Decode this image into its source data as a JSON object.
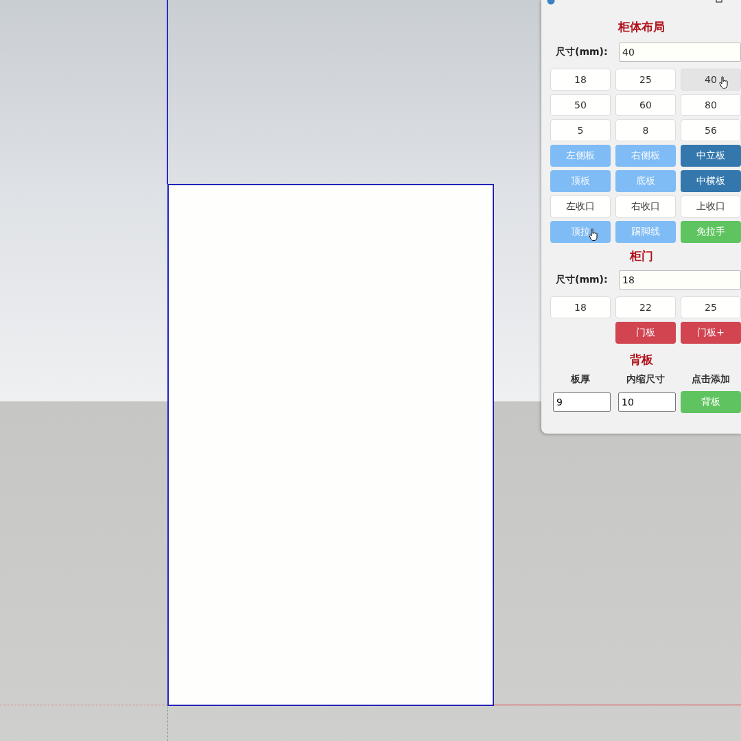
{
  "layout_section": {
    "title": "柜体布局",
    "size_label": "尺寸(mm):",
    "size_value": "40",
    "buttons": [
      {
        "label": "18",
        "kind": "plain",
        "hovered": false,
        "pointer": false
      },
      {
        "label": "25",
        "kind": "plain",
        "hovered": false,
        "pointer": false
      },
      {
        "label": "40",
        "kind": "plain",
        "hovered": true,
        "pointer": true
      },
      {
        "label": "50",
        "kind": "plain",
        "hovered": false,
        "pointer": false
      },
      {
        "label": "60",
        "kind": "plain",
        "hovered": false,
        "pointer": false
      },
      {
        "label": "80",
        "kind": "plain",
        "hovered": false,
        "pointer": false
      },
      {
        "label": "5",
        "kind": "plain",
        "hovered": false,
        "pointer": false
      },
      {
        "label": "8",
        "kind": "plain",
        "hovered": false,
        "pointer": false
      },
      {
        "label": "56",
        "kind": "plain",
        "hovered": false,
        "pointer": false
      },
      {
        "label": "左侧板",
        "kind": "light",
        "hovered": false,
        "pointer": false
      },
      {
        "label": "右侧板",
        "kind": "light",
        "hovered": false,
        "pointer": false
      },
      {
        "label": "中立板",
        "kind": "dark",
        "hovered": false,
        "pointer": false
      },
      {
        "label": "顶板",
        "kind": "light",
        "hovered": false,
        "pointer": false
      },
      {
        "label": "底板",
        "kind": "light",
        "hovered": false,
        "pointer": false
      },
      {
        "label": "中横板",
        "kind": "dark",
        "hovered": false,
        "pointer": false
      },
      {
        "label": "左收口",
        "kind": "plain",
        "hovered": false,
        "pointer": false
      },
      {
        "label": "右收口",
        "kind": "plain",
        "hovered": false,
        "pointer": false
      },
      {
        "label": "上收口",
        "kind": "plain",
        "hovered": false,
        "pointer": false
      },
      {
        "label": "顶拉",
        "kind": "light",
        "hovered": false,
        "pointer": true
      },
      {
        "label": "踢脚线",
        "kind": "light",
        "hovered": false,
        "pointer": false
      },
      {
        "label": "免拉手",
        "kind": "green",
        "hovered": false,
        "pointer": false
      }
    ]
  },
  "door_section": {
    "title": "柜门",
    "size_label": "尺寸(mm):",
    "size_value": "18",
    "buttons": [
      {
        "label": "18",
        "kind": "plain"
      },
      {
        "label": "22",
        "kind": "plain"
      },
      {
        "label": "25",
        "kind": "plain"
      },
      {
        "label": "门板",
        "kind": "red"
      },
      {
        "label": "门板+",
        "kind": "red"
      }
    ]
  },
  "back_section": {
    "title": "背板",
    "columns": [
      "板厚",
      "内缩尺寸",
      "点击添加"
    ],
    "thickness_value": "9",
    "inset_value": "10",
    "add_button": {
      "label": "背板",
      "kind": "green"
    }
  }
}
